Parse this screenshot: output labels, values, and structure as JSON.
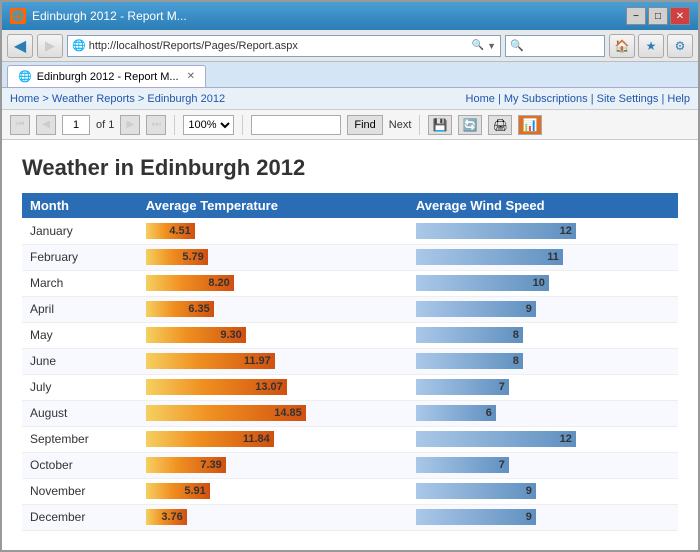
{
  "window": {
    "title": "Edinburgh 2012 - Report M...",
    "controls": {
      "minimize": "−",
      "maximize": "□",
      "close": "✕"
    }
  },
  "browser": {
    "address": "http://localhost/Reports/Pages/Report.aspx",
    "back_btn": "◀",
    "forward_btn": "▶",
    "search_placeholder": ""
  },
  "tab": {
    "label": "Edinburgh 2012 - Report M...",
    "close": "✕"
  },
  "menubar": {
    "left": {
      "home": "Home",
      "sep1": " > ",
      "weather": "Weather Reports",
      "sep2": " > ",
      "edinburgh": "Edinburgh 2012"
    },
    "right": {
      "home": "Home",
      "sep1": " | ",
      "subscriptions": "My Subscriptions",
      "sep2": " | ",
      "settings": "Site Settings",
      "sep3": " | ",
      "help": "Help"
    }
  },
  "toolbar": {
    "page_value": "1",
    "page_of": "of 1",
    "zoom_value": "100%",
    "find_placeholder": "",
    "find_btn": "Find",
    "next_btn": "Next"
  },
  "report": {
    "title": "Weather in Edinburgh 2012",
    "headers": {
      "month": "Month",
      "temp": "Average Temperature",
      "wind": "Average Wind Speed"
    },
    "rows": [
      {
        "month": "January",
        "temp": 4.51,
        "wind": 12
      },
      {
        "month": "February",
        "temp": 5.79,
        "wind": 11
      },
      {
        "month": "March",
        "temp": 8.2,
        "wind": 10
      },
      {
        "month": "April",
        "temp": 6.35,
        "wind": 9
      },
      {
        "month": "May",
        "temp": 9.3,
        "wind": 8
      },
      {
        "month": "June",
        "temp": 11.97,
        "wind": 8
      },
      {
        "month": "July",
        "temp": 13.07,
        "wind": 7
      },
      {
        "month": "August",
        "temp": 14.85,
        "wind": 6
      },
      {
        "month": "September",
        "temp": 11.84,
        "wind": 12
      },
      {
        "month": "October",
        "temp": 7.39,
        "wind": 7
      },
      {
        "month": "November",
        "temp": 5.91,
        "wind": 9
      },
      {
        "month": "December",
        "temp": 3.76,
        "wind": 9
      }
    ],
    "temp_max": 14.85,
    "wind_max": 12,
    "temp_bar_width": 160,
    "wind_bar_width": 160
  }
}
